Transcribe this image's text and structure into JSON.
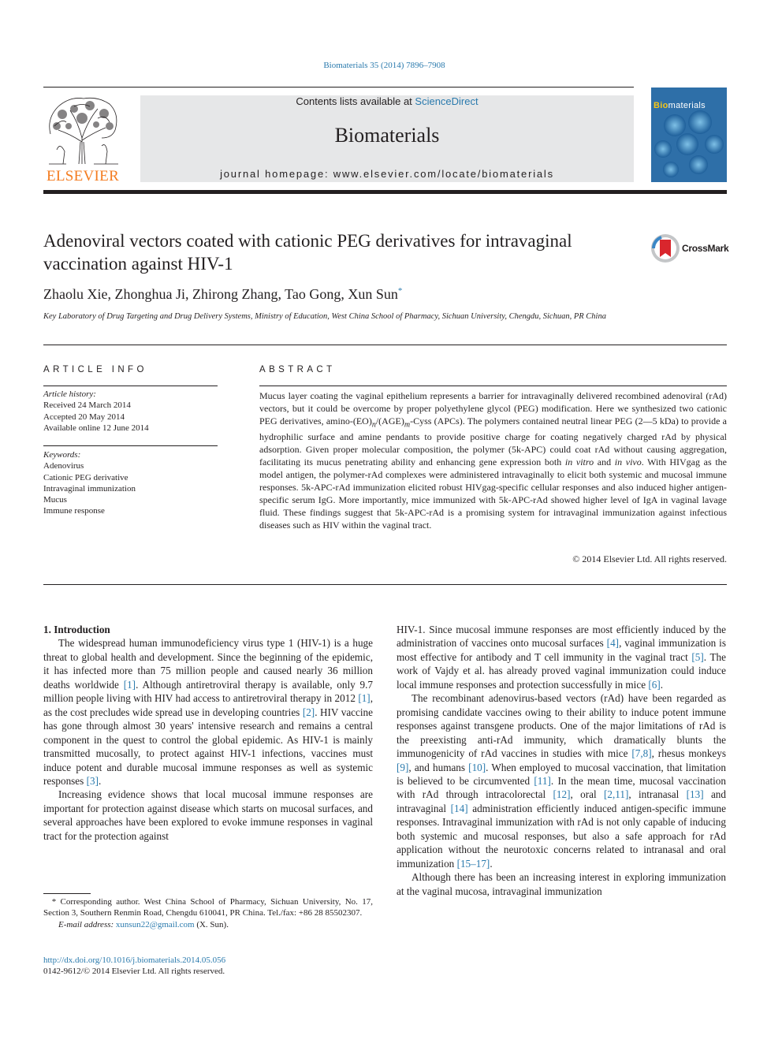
{
  "header": {
    "citation": "Biomaterials 35 (2014) 7896–7908",
    "contents_prefix": "Contents lists available at ",
    "contents_link": "ScienceDirect",
    "journal_title": "Biomaterials",
    "homepage": "journal homepage: www.elsevier.com/locate/biomaterials",
    "publisher_logo_text": "ELSEVIER",
    "cover_title_bold": "Bio",
    "cover_title_rest": "materials"
  },
  "crossmark_label": "CrossMark",
  "article": {
    "title": "Adenoviral vectors coated with cationic PEG derivatives for intravaginal vaccination against HIV-1",
    "authors": "Zhaolu Xie, Zhonghua Ji, Zhirong Zhang, Tao Gong, Xun Sun",
    "corresponding_mark": "*",
    "affiliation": "Key Laboratory of Drug Targeting and Drug Delivery Systems, Ministry of Education, West China School of Pharmacy, Sichuan University, Chengdu, Sichuan, PR China"
  },
  "article_info": {
    "heading": "ARTICLE INFO",
    "history_label": "Article history:",
    "history": [
      "Received 24 March 2014",
      "Accepted 20 May 2014",
      "Available online 12 June 2014"
    ],
    "keywords_label": "Keywords:",
    "keywords": [
      "Adenovirus",
      "Cationic PEG derivative",
      "Intravaginal immunization",
      "Mucus",
      "Immune response"
    ]
  },
  "abstract": {
    "heading": "ABSTRACT",
    "text_1": "Mucus layer coating the vaginal epithelium represents a barrier for intravaginally delivered recombined adenoviral (rAd) vectors, but it could be overcome by proper polyethylene glycol (PEG) modification. Here we synthesized two cationic PEG derivatives, amino-(EO)",
    "sub_n": "n",
    "text_2": "/(AGE)",
    "sub_m": "m",
    "text_3": "-Cyss (APCs). The polymers contained neutral linear PEG (2—5 kDa) to provide a hydrophilic surface and amine pendants to provide positive charge for coating negatively charged rAd by physical adsorption. Given proper molecular composition, the polymer (5k-APC) could coat rAd without causing aggregation, facilitating its mucus penetrating ability and enhancing gene expression both ",
    "in_vitro": "in vitro",
    "text_4": " and ",
    "in_vivo": "in vivo",
    "text_5": ". With HIVgag as the model antigen, the polymer-rAd complexes were administered intravaginally to elicit both systemic and mucosal immune responses. 5k-APC-rAd immunization elicited robust HIVgag-specific cellular responses and also induced higher antigen-specific serum IgG. More importantly, mice immunized with 5k-APC-rAd showed higher level of IgA in vaginal lavage fluid. These findings suggest that 5k-APC-rAd is a promising system for intravaginal immunization against infectious diseases such as HIV within the vaginal tract.",
    "copyright": "© 2014 Elsevier Ltd. All rights reserved."
  },
  "body": {
    "section_heading": "1.  Introduction",
    "left_p1": [
      {
        "t": "The widespread human immunodeficiency virus type 1 (HIV-1) is a huge threat to global health and development. Since the beginning of the epidemic, it has infected more than 75 million people and caused nearly 36 million deaths worldwide "
      },
      {
        "ref": "[1]"
      },
      {
        "t": ". Although antiretroviral therapy is available, only 9.7 million people living with HIV had access to antiretroviral therapy in 2012 "
      },
      {
        "ref": "[1]"
      },
      {
        "t": ", as the cost precludes wide spread use in developing countries "
      },
      {
        "ref": "[2]"
      },
      {
        "t": ". HIV vaccine has gone through almost 30 years' intensive research and remains a central component in the quest to control the global epidemic. As HIV-1 is mainly transmitted mucosally, to protect against HIV-1 infections, vaccines must induce potent and durable mucosal immune responses as well as systemic responses "
      },
      {
        "ref": "[3]"
      },
      {
        "t": "."
      }
    ],
    "left_p2": "Increasing evidence shows that local mucosal immune responses are important for protection against disease which starts on mucosal surfaces, and several approaches have been explored to evoke immune responses in vaginal tract for the protection against",
    "right_p1": [
      {
        "t": "HIV-1. Since mucosal immune responses are most efficiently induced by the administration of vaccines onto mucosal surfaces "
      },
      {
        "ref": "[4]"
      },
      {
        "t": ", vaginal immunization is most effective for antibody and T cell immunity in the vaginal tract "
      },
      {
        "ref": "[5]"
      },
      {
        "t": ". The work of Vajdy et al. has already proved vaginal immunization could induce local immune responses and protection successfully in mice "
      },
      {
        "ref": "[6]"
      },
      {
        "t": "."
      }
    ],
    "right_p2": [
      {
        "t": "The recombinant adenovirus-based vectors (rAd) have been regarded as promising candidate vaccines owing to their ability to induce potent immune responses against transgene products. One of the major limitations of rAd is the preexisting anti-rAd immunity, which dramatically blunts the immunogenicity of rAd vaccines in studies with mice "
      },
      {
        "ref": "[7,8]"
      },
      {
        "t": ", rhesus monkeys "
      },
      {
        "ref": "[9]"
      },
      {
        "t": ", and humans "
      },
      {
        "ref": "[10]"
      },
      {
        "t": ". When employed to mucosal vaccination, that limitation is believed to be circumvented "
      },
      {
        "ref": "[11]"
      },
      {
        "t": ". In the mean time, mucosal vaccination with rAd through intracolorectal "
      },
      {
        "ref": "[12]"
      },
      {
        "t": ", oral "
      },
      {
        "ref": "[2,11]"
      },
      {
        "t": ", intranasal "
      },
      {
        "ref": "[13]"
      },
      {
        "t": " and intravaginal "
      },
      {
        "ref": "[14]"
      },
      {
        "t": " administration efficiently induced antigen-specific immune responses. Intravaginal immunization with rAd is not only capable of inducing both systemic and mucosal responses, but also a safe approach for rAd application without the neurotoxic concerns related to intranasal and oral immunization "
      },
      {
        "ref": "[15–17]"
      },
      {
        "t": "."
      }
    ],
    "right_p3": "Although there has been an increasing interest in exploring immunization at the vaginal mucosa, intravaginal immunization"
  },
  "footnote": {
    "mark": "*",
    "corresponding": "Corresponding author. West China School of Pharmacy, Sichuan University, No. 17, Section 3, Southern Renmin Road, Chengdu 610041, PR China. Tel./fax: +86 28 85502307.",
    "email_label": "E-mail address:",
    "email": "xunsun22@gmail.com",
    "email_suffix": " (X. Sun)."
  },
  "doi": {
    "link": "http://dx.doi.org/10.1016/j.biomaterials.2014.05.056",
    "issn_line": "0142-9612/© 2014 Elsevier Ltd. All rights reserved."
  },
  "colors": {
    "link": "#2a7aad",
    "elsevier_orange": "#f47c20",
    "masthead_gray": "#e6e7e8",
    "text": "#231f20"
  }
}
